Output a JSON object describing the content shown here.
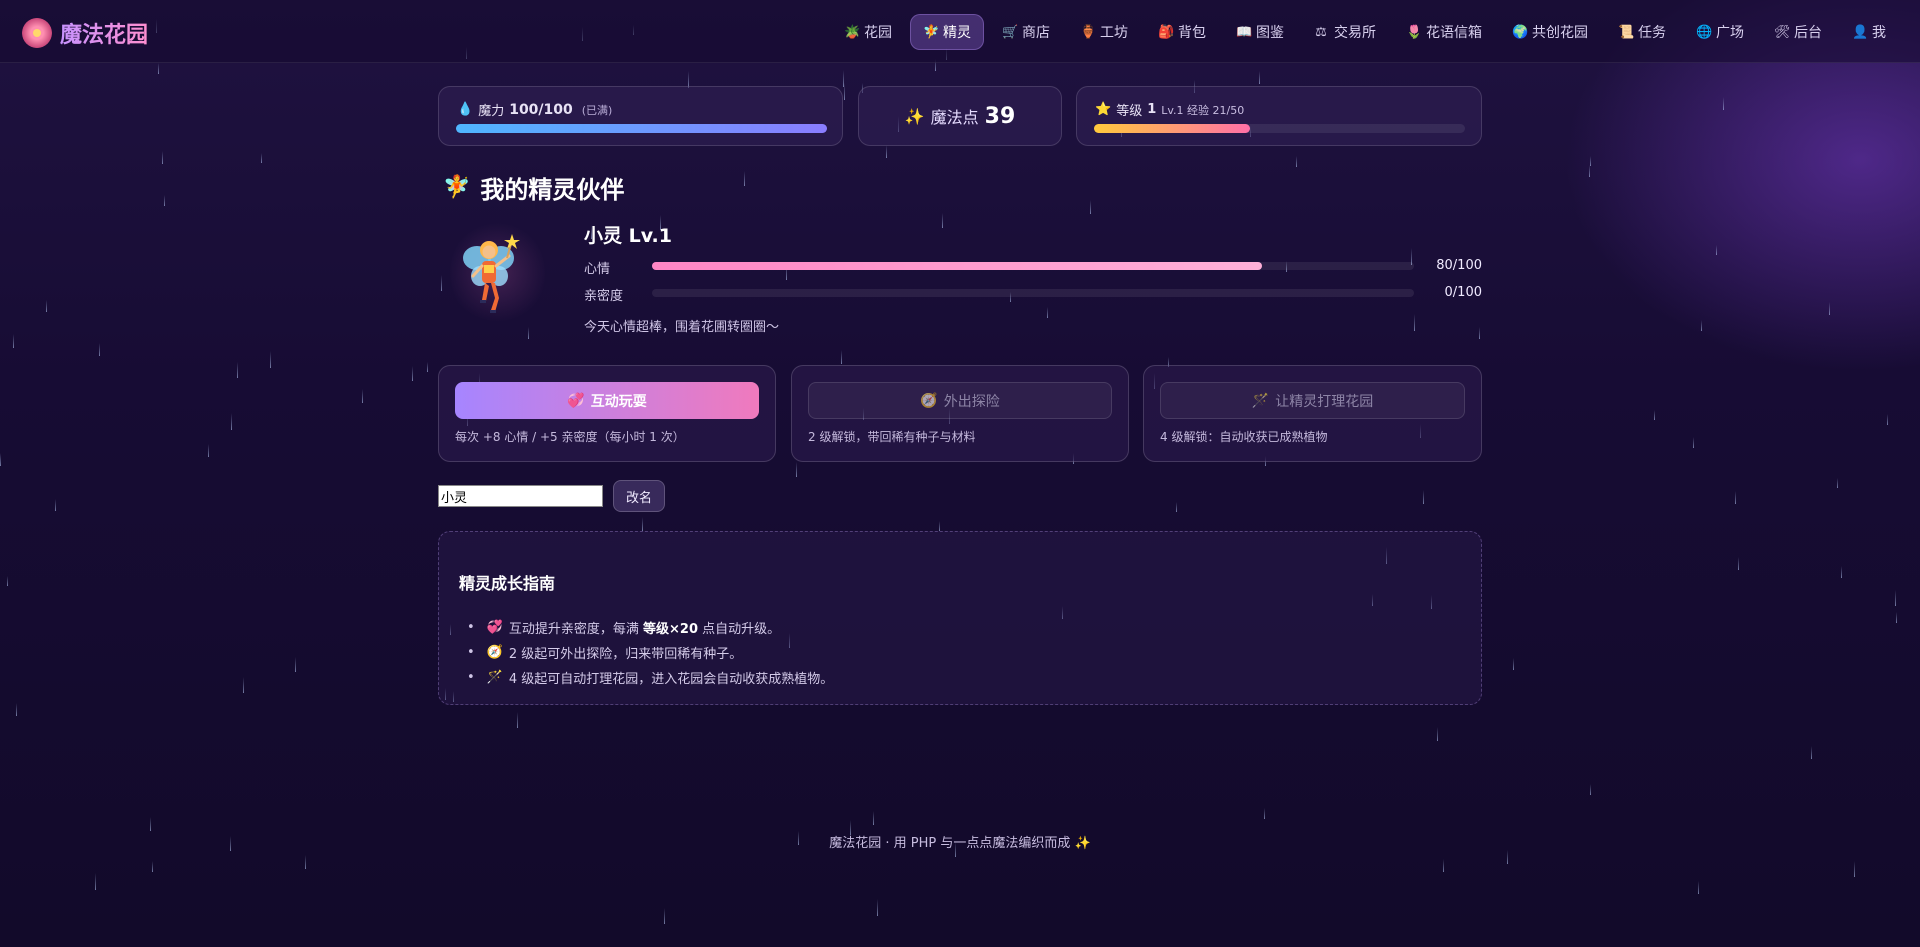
{
  "brand": {
    "name": "魔法花园"
  },
  "nav": [
    {
      "icon": "🪴",
      "label": "花园",
      "icon_name": "plant-icon"
    },
    {
      "icon": "🧚",
      "label": "精灵",
      "icon_name": "fairy-icon",
      "active": true
    },
    {
      "icon": "🛒",
      "label": "商店",
      "icon_name": "cart-icon"
    },
    {
      "icon": "🏺",
      "label": "工坊",
      "icon_name": "workshop-icon"
    },
    {
      "icon": "🎒",
      "label": "背包",
      "icon_name": "backpack-icon"
    },
    {
      "icon": "📖",
      "label": "图鉴",
      "icon_name": "book-icon"
    },
    {
      "icon": "⚖",
      "label": "交易所",
      "icon_name": "scale-icon"
    },
    {
      "icon": "🌷",
      "label": "花语信箱",
      "icon_name": "tulip-icon"
    },
    {
      "icon": "🌍",
      "label": "共创花园",
      "icon_name": "globe-icon"
    },
    {
      "icon": "📜",
      "label": "任务",
      "icon_name": "scroll-icon"
    },
    {
      "icon": "🌐",
      "label": "广场",
      "icon_name": "network-icon"
    },
    {
      "icon": "🛠",
      "label": "后台",
      "icon_name": "tools-icon"
    },
    {
      "icon": "👤",
      "label": "我",
      "icon_name": "user-icon"
    }
  ],
  "stats": {
    "mana": {
      "icon": "💧",
      "label": "魔力",
      "value": "100/100",
      "note": "(已满)",
      "fraction": 1.0,
      "gradient": [
        "#4fb6ff",
        "#8a7dff"
      ]
    },
    "points": {
      "icon": "✨",
      "label": "魔法点",
      "value": "39"
    },
    "level": {
      "icon": "⭐",
      "label": "等级",
      "value": "1",
      "exp_text": "Lv.1 经验 21/50",
      "fraction": 0.42,
      "gradient": [
        "#ffc93c",
        "#ff6fa8"
      ]
    }
  },
  "fairy_section": {
    "title_icon": "🧚",
    "title": "我的精灵伙伴",
    "name": "小灵 Lv.1",
    "mood": {
      "label": "心情",
      "value": "80/100",
      "fraction": 0.8
    },
    "intimacy": {
      "label": "亲密度",
      "value": "0/100",
      "fraction": 0.0
    },
    "status": "今天心情超棒，围着花圃转圈圈～"
  },
  "actions": [
    {
      "icon": "💞",
      "label": "互动玩耍",
      "desc": "每次 +8 心情 / +5 亲密度（每小时 1 次）",
      "enabled": true
    },
    {
      "icon": "🧭",
      "label": "外出探险",
      "desc": "2 级解锁，带回稀有种子与材料",
      "enabled": false
    },
    {
      "icon": "🪄",
      "label": "让精灵打理花园",
      "desc": "4 级解锁：自动收获已成熟植物",
      "enabled": false
    }
  ],
  "rename": {
    "value": "小灵",
    "button": "改名"
  },
  "guide": {
    "title": "精灵成长指南",
    "items": [
      {
        "icon": "💞",
        "pre": "互动提升亲密度，每满 ",
        "bold": "等级×20",
        "post": " 点自动升级。"
      },
      {
        "icon": "🧭",
        "pre": "2 级起可外出探险，归来带回稀有种子。",
        "bold": "",
        "post": ""
      },
      {
        "icon": "🪄",
        "pre": "4 级起可自动打理花园，进入花园会自动收获成熟植物。",
        "bold": "",
        "post": ""
      }
    ]
  },
  "footer": "魔法花园 · 用 PHP 与一点点魔法编织而成 ✨"
}
